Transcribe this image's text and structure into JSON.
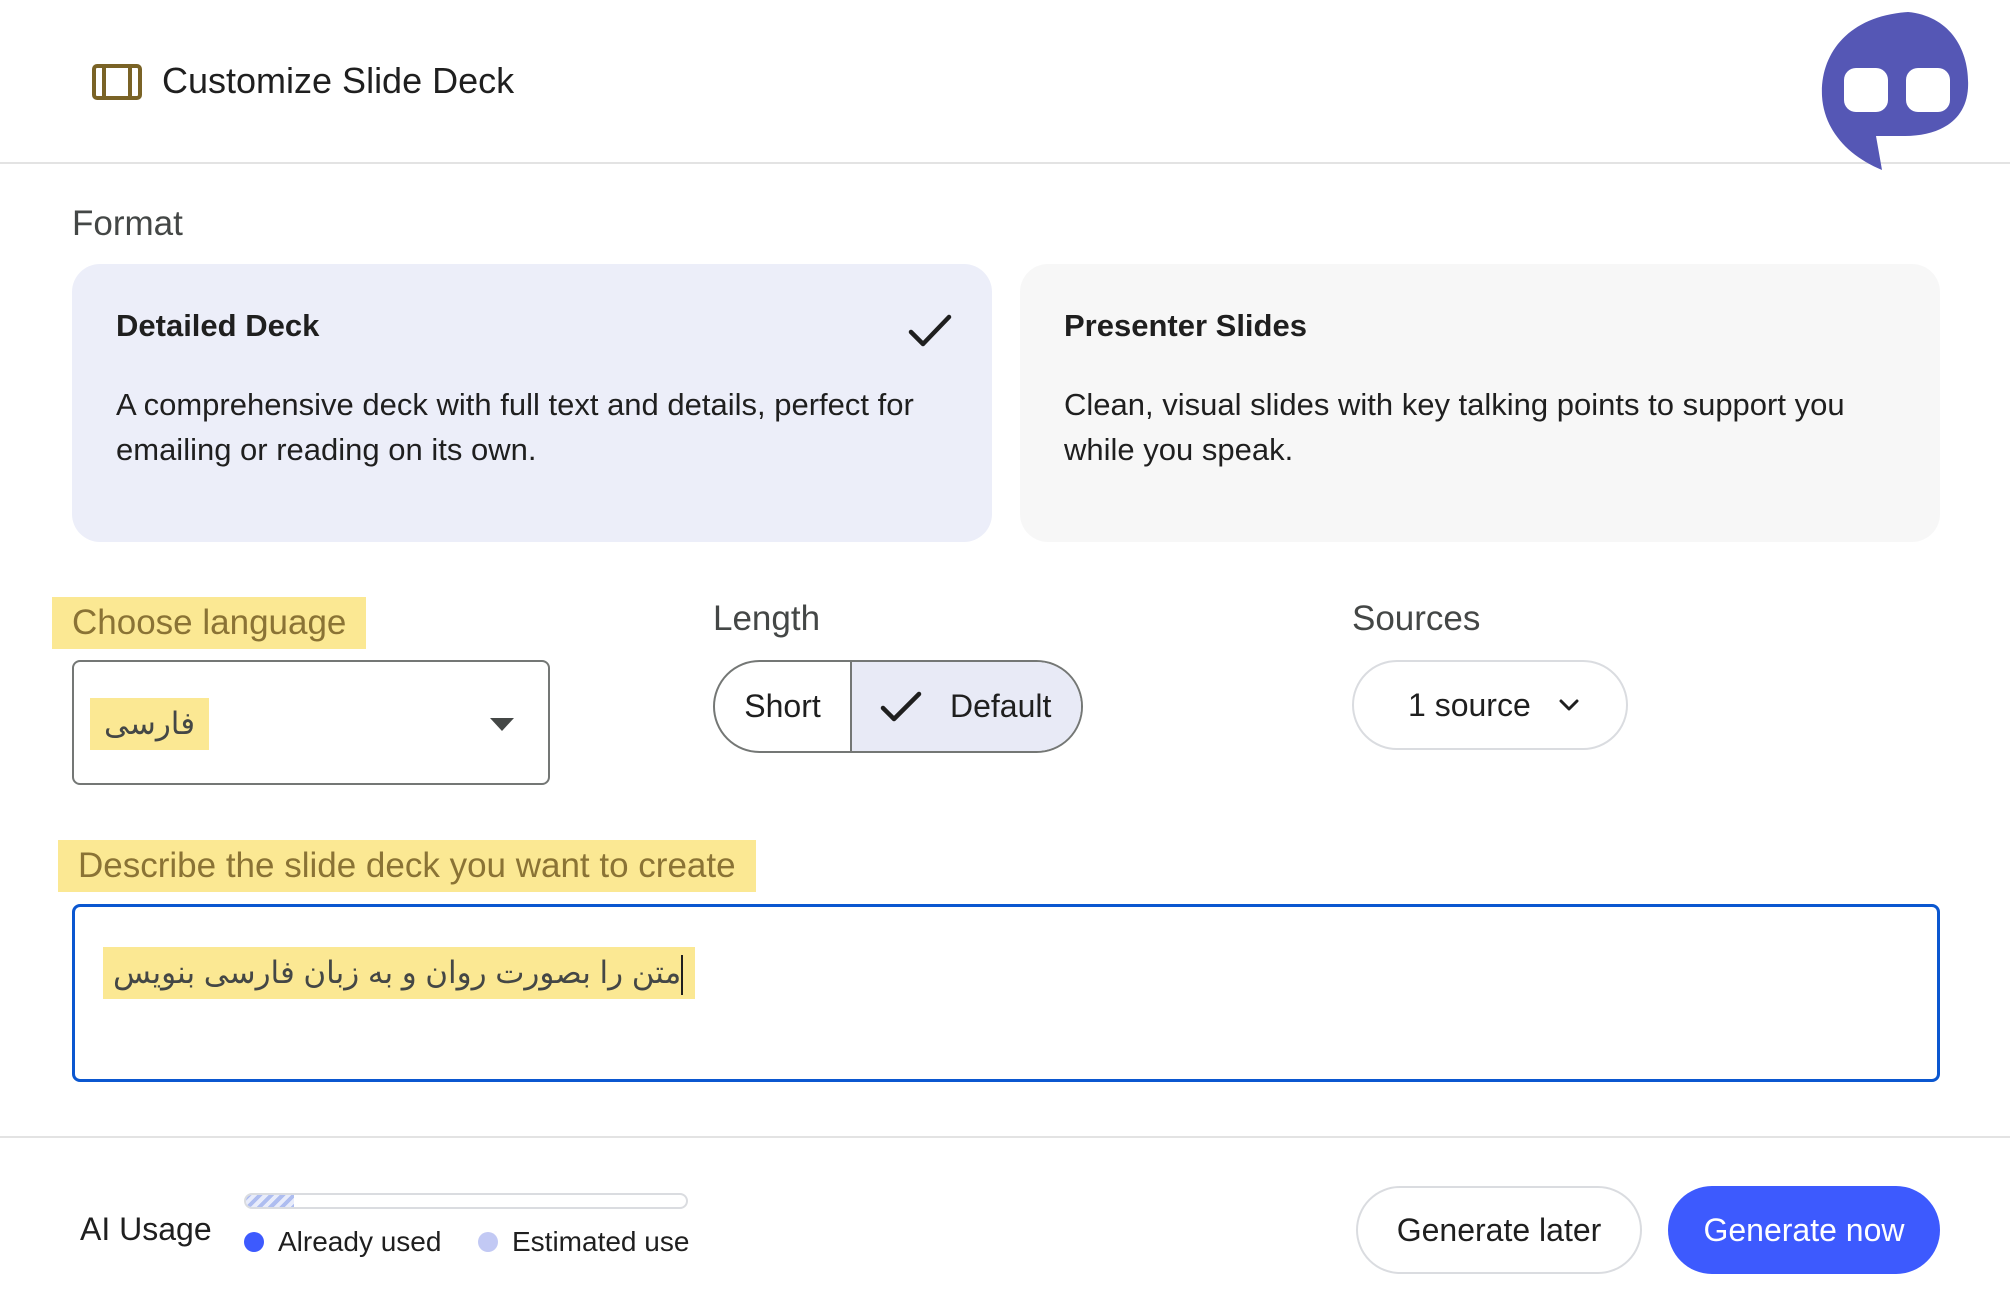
{
  "dialog": {
    "title": "Customize Slide Deck",
    "icon": "slides-icon"
  },
  "format": {
    "label": "Format",
    "options": [
      {
        "title": "Detailed Deck",
        "description": "A comprehensive deck with full text and details, perfect for emailing or reading on its own.",
        "selected": true
      },
      {
        "title": "Presenter Slides",
        "description": "Clean, visual slides with key talking points to support you while you speak.",
        "selected": false
      }
    ]
  },
  "language": {
    "label": "Choose language",
    "value": "فارسی"
  },
  "length": {
    "label": "Length",
    "options": [
      "Short",
      "Default"
    ],
    "selected": "Default"
  },
  "sources": {
    "label": "Sources",
    "value": "1 source"
  },
  "prompt": {
    "label": "Describe the slide deck you want to create",
    "value": "متن را بصورت روان و به زبان فارسی بنویس"
  },
  "footer": {
    "usage_label": "AI Usage",
    "usage_fraction": 0.11,
    "legend_used": "Already used",
    "legend_estimated": "Estimated use",
    "generate_later": "Generate later",
    "generate_now": "Generate now"
  },
  "colors": {
    "accent": "#3d5afe",
    "focus_border": "#0b57d0",
    "selected_card": "#eceef9",
    "highlight": "#fbe893",
    "already_used_dot": "#3d5afe",
    "estimated_dot": "#c2c9f4",
    "bot_logo": "#5557b5"
  }
}
